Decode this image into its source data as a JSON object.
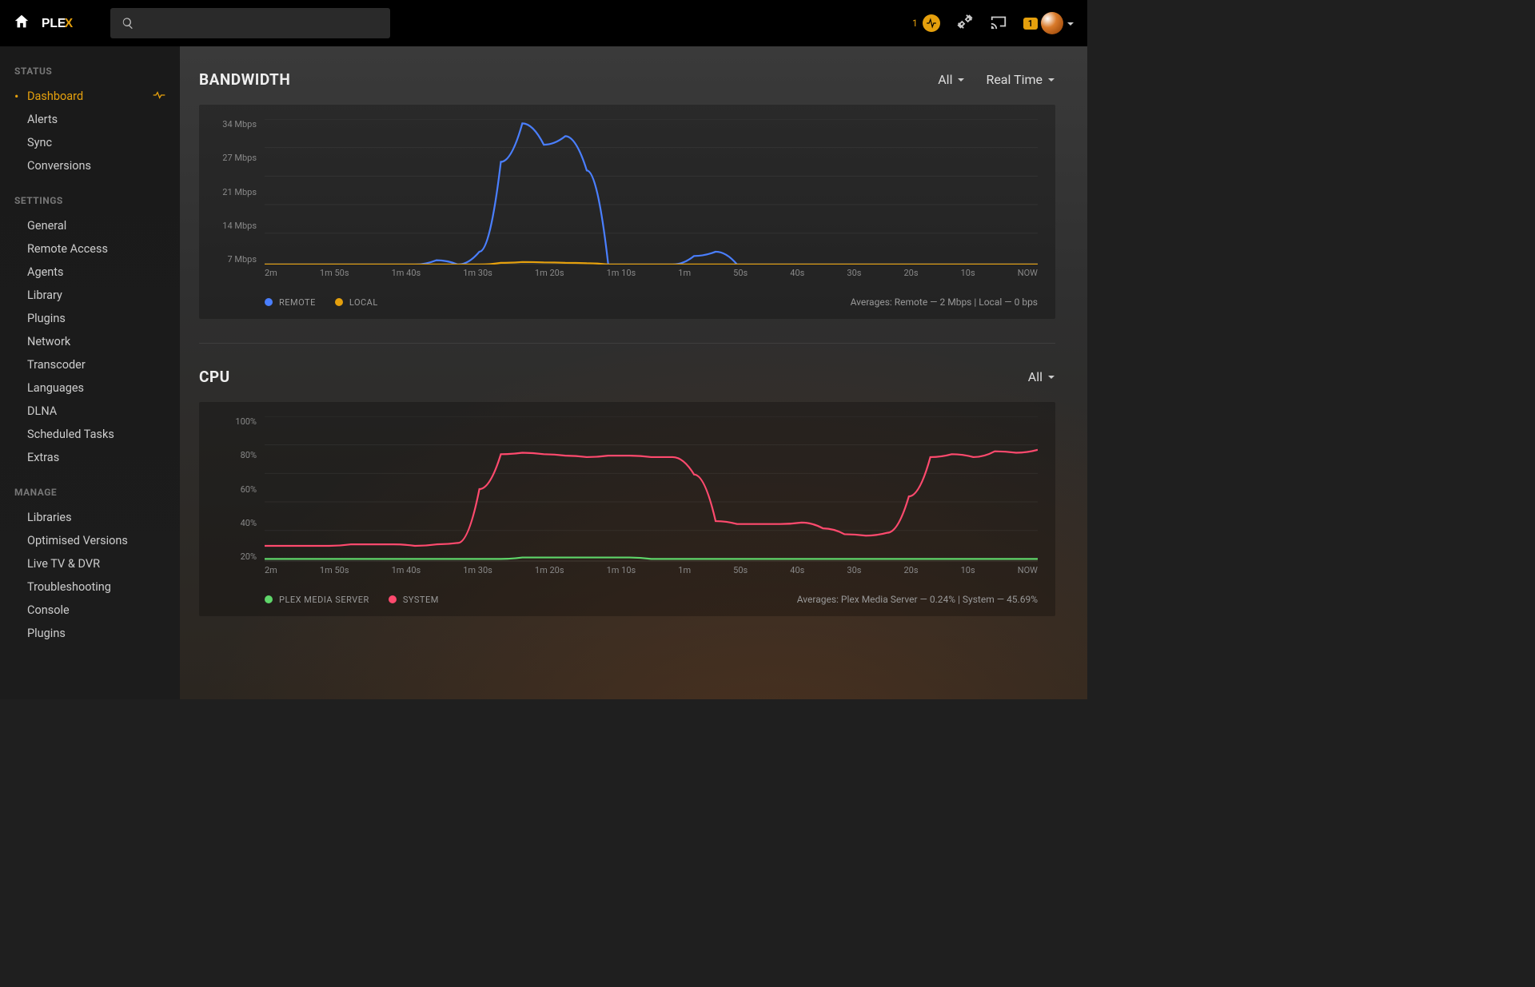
{
  "topbar": {
    "alert_count": "1",
    "user_badge": "1"
  },
  "sidebar": {
    "sections": [
      {
        "heading": "STATUS",
        "items": [
          {
            "label": "Dashboard",
            "active": true,
            "icon": true
          },
          {
            "label": "Alerts"
          },
          {
            "label": "Sync"
          },
          {
            "label": "Conversions"
          }
        ]
      },
      {
        "heading": "SETTINGS",
        "items": [
          {
            "label": "General"
          },
          {
            "label": "Remote Access"
          },
          {
            "label": "Agents"
          },
          {
            "label": "Library"
          },
          {
            "label": "Plugins"
          },
          {
            "label": "Network"
          },
          {
            "label": "Transcoder"
          },
          {
            "label": "Languages"
          },
          {
            "label": "DLNA"
          },
          {
            "label": "Scheduled Tasks"
          },
          {
            "label": "Extras"
          }
        ]
      },
      {
        "heading": "MANAGE",
        "items": [
          {
            "label": "Libraries"
          },
          {
            "label": "Optimised Versions"
          },
          {
            "label": "Live TV & DVR"
          },
          {
            "label": "Troubleshooting"
          },
          {
            "label": "Console"
          },
          {
            "label": "Plugins"
          }
        ]
      }
    ]
  },
  "bandwidth": {
    "title": "BANDWIDTH",
    "filter1": "All",
    "filter2": "Real Time",
    "legend1": "REMOTE",
    "legend2": "LOCAL",
    "averages": "Averages: Remote — 2 Mbps | Local — 0 bps",
    "y_ticks": [
      "34 Mbps",
      "27 Mbps",
      "21 Mbps",
      "14 Mbps",
      "7 Mbps"
    ],
    "x_ticks": [
      "2m",
      "1m 50s",
      "1m 40s",
      "1m 30s",
      "1m 20s",
      "1m 10s",
      "1m",
      "50s",
      "40s",
      "30s",
      "20s",
      "10s",
      "NOW"
    ]
  },
  "cpu": {
    "title": "CPU",
    "filter1": "All",
    "legend1": "PLEX MEDIA SERVER",
    "legend2": "SYSTEM",
    "averages": "Averages: Plex Media Server — 0.24% | System — 45.69%",
    "y_ticks": [
      "100%",
      "80%",
      "60%",
      "40%",
      "20%"
    ],
    "x_ticks": [
      "2m",
      "1m 50s",
      "1m 40s",
      "1m 30s",
      "1m 20s",
      "1m 10s",
      "1m",
      "50s",
      "40s",
      "30s",
      "20s",
      "10s",
      "NOW"
    ]
  },
  "colors": {
    "remote": "#4a7fff",
    "local": "#e5a00d",
    "pms": "#5fd66a",
    "system": "#ff4a6e"
  },
  "chart_data": [
    {
      "type": "line",
      "title": "BANDWIDTH",
      "xlabel": "",
      "ylabel": "Mbps",
      "ylim": [
        0,
        34
      ],
      "categories": [
        "2m",
        "1m 50s",
        "1m 40s",
        "1m 30s",
        "1m 20s",
        "1m 10s",
        "1m",
        "50s",
        "40s",
        "30s",
        "20s",
        "10s",
        "NOW"
      ],
      "series": [
        {
          "name": "REMOTE",
          "color": "#4a7fff",
          "values": [
            0,
            0,
            0,
            0,
            0,
            0,
            0,
            0,
            1,
            0,
            3,
            24,
            33,
            28,
            30,
            22,
            0,
            0,
            0,
            0,
            2,
            3,
            0,
            0,
            0,
            0,
            0,
            0,
            0,
            0,
            0,
            0,
            0,
            0,
            0,
            0,
            0
          ]
        },
        {
          "name": "LOCAL",
          "color": "#e5a00d",
          "values": [
            0,
            0,
            0,
            0,
            0,
            0,
            0,
            0,
            0,
            0,
            0,
            0.4,
            0.6,
            0.5,
            0.4,
            0.3,
            0,
            0,
            0,
            0,
            0,
            0,
            0,
            0,
            0,
            0,
            0,
            0,
            0,
            0,
            0,
            0,
            0,
            0,
            0,
            0,
            0
          ]
        }
      ],
      "averages_text": "Averages: Remote — 2 Mbps | Local — 0 bps"
    },
    {
      "type": "line",
      "title": "CPU",
      "xlabel": "",
      "ylabel": "%",
      "ylim": [
        0,
        100
      ],
      "categories": [
        "2m",
        "1m 50s",
        "1m 40s",
        "1m 30s",
        "1m 20s",
        "1m 10s",
        "1m",
        "50s",
        "40s",
        "30s",
        "20s",
        "10s",
        "NOW"
      ],
      "series": [
        {
          "name": "PLEX MEDIA SERVER",
          "color": "#5fd66a",
          "values": [
            2,
            2,
            2,
            2,
            2,
            2,
            2,
            2,
            2,
            2,
            2,
            2,
            3,
            3,
            3,
            3,
            3,
            3,
            2,
            2,
            2,
            2,
            2,
            2,
            2,
            2,
            2,
            2,
            2,
            2,
            2,
            2,
            2,
            2,
            2,
            2,
            2
          ]
        },
        {
          "name": "SYSTEM",
          "color": "#ff4a6e",
          "values": [
            11,
            11,
            11,
            11,
            12,
            12,
            12,
            11,
            12,
            13,
            50,
            74,
            75,
            74,
            73,
            72,
            73,
            73,
            72,
            72,
            60,
            28,
            26,
            26,
            26,
            27,
            23,
            19,
            18,
            20,
            45,
            72,
            74,
            72,
            76,
            75,
            77
          ]
        }
      ],
      "averages_text": "Averages: Plex Media Server — 0.24% | System — 45.69%"
    }
  ]
}
